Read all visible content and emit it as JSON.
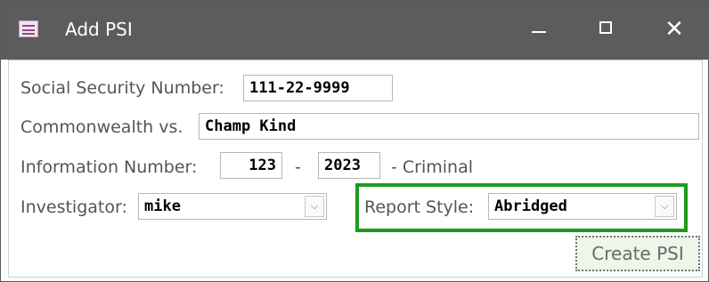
{
  "window": {
    "title": "Add PSI",
    "minimize_glyph": "—",
    "maximize_glyph": "☐",
    "close_glyph": "✕",
    "icon": "access-form-icon"
  },
  "form": {
    "ssn_label": "Social Security Number:",
    "ssn_value": "111-22-9999",
    "commonwealth_label": "Commonwealth vs.",
    "commonwealth_value": "Champ Kind",
    "info_label": "Information Number:",
    "info_number": "123",
    "dash": "-",
    "info_year": "2023",
    "criminal_label": "- Criminal",
    "investigator_label": "Investigator:",
    "investigator_value": "mike",
    "report_style_label": "Report Style:",
    "report_style_value": "Abridged",
    "dropdown_glyph": "⌵",
    "create_button": "Create PSI"
  },
  "colors": {
    "titlebar": "#5c5c5c",
    "highlight": "#1e9a1e",
    "button_bg": "#eef6ea"
  }
}
